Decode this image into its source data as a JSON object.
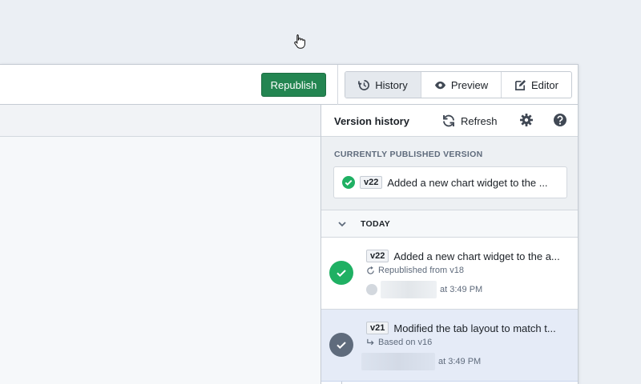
{
  "toolbar": {
    "republish_label": "Republish",
    "views": [
      {
        "label": "History",
        "icon": "history-icon",
        "active": true
      },
      {
        "label": "Preview",
        "icon": "eye-icon",
        "active": false
      },
      {
        "label": "Editor",
        "icon": "edit-icon",
        "active": false
      }
    ]
  },
  "panel": {
    "title": "Version history",
    "refresh_label": "Refresh"
  },
  "published": {
    "section_label": "CURRENTLY PUBLISHED VERSION",
    "version": "v22",
    "title": "Added a new chart widget to the ..."
  },
  "group": {
    "label": "TODAY"
  },
  "versions": [
    {
      "version": "v22",
      "title": "Added a new chart widget to the a...",
      "subtitle": "Republished from v18",
      "time": "at 3:49 PM",
      "status": "published"
    },
    {
      "version": "v21",
      "title": "Modified the tab layout to match t...",
      "subtitle": "Based on v16",
      "time": "at 3:49 PM",
      "status": "selected"
    }
  ],
  "colors": {
    "republish": "#238551",
    "published_green": "#1fb063",
    "selected_row": "#e5ebf7",
    "node_dark": "#5f6b7c"
  }
}
